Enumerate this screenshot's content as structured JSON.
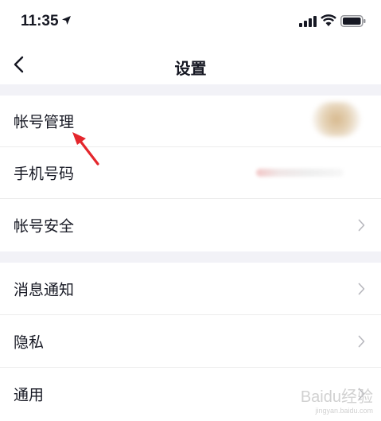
{
  "status_bar": {
    "time": "11:35",
    "icons": [
      "location-arrow-icon",
      "signal-icon",
      "wifi-icon",
      "battery-icon"
    ]
  },
  "nav": {
    "title": "设置",
    "back_icon": "chevron-left-icon"
  },
  "sections": [
    {
      "rows": [
        {
          "label": "帐号管理",
          "value": "(blurred avatar)",
          "chevron": false
        },
        {
          "label": "手机号码",
          "value": "(blurred phone number)",
          "chevron": false
        },
        {
          "label": "帐号安全",
          "chevron": true
        }
      ]
    },
    {
      "rows": [
        {
          "label": "消息通知",
          "chevron": true
        },
        {
          "label": "隐私",
          "chevron": true
        },
        {
          "label": "通用",
          "chevron": true
        }
      ]
    }
  ],
  "annotation": {
    "type": "red-arrow",
    "points_to": "帐号管理",
    "color": "#e4262c"
  },
  "watermark": {
    "brand": "Baidu经验",
    "url": "jingyan.baidu.com"
  },
  "colors": {
    "background": "#f2f2f7",
    "card": "#ffffff",
    "text": "#161823",
    "chevron": "#b7b7bd",
    "divider": "#ececec"
  }
}
